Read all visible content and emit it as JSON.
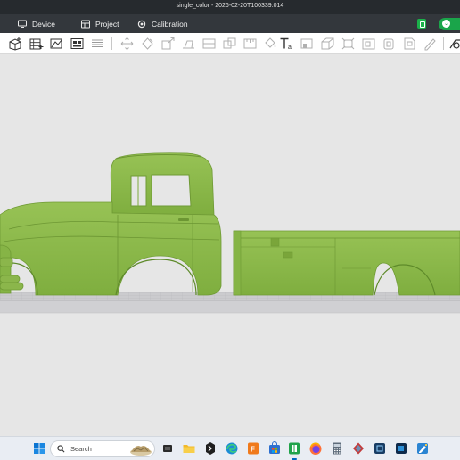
{
  "window": {
    "title": "single_color - 2026-02-20T100339.014"
  },
  "menu": {
    "items": [
      {
        "label": "Device",
        "icon": "monitor-icon"
      },
      {
        "label": "Project",
        "icon": "project-icon"
      },
      {
        "label": "Calibration",
        "icon": "calibration-icon"
      }
    ]
  },
  "toolbar": {
    "tools": [
      "add-object",
      "add-plate",
      "auto-orient",
      "arrange",
      "split-objects",
      "move",
      "rotate",
      "scale",
      "lay-on-face",
      "cut",
      "boolean",
      "measure",
      "assembly",
      "seam-painting",
      "support-painting",
      "text",
      "support",
      "multi-object",
      "orient-plate",
      "lay-flat",
      "variable-layer-height",
      "pin",
      "brim-ears",
      "emboss"
    ]
  },
  "viewport": {
    "model_color": "#8db84a",
    "plate_color": "#c9c9cc",
    "background": "#e6e6e6"
  },
  "taskbar": {
    "search_placeholder": "Search",
    "apps": [
      "windows-start",
      "search",
      "news-widget",
      "task-view",
      "file-explorer",
      "terminal",
      "edge",
      "fusion",
      "ms-store",
      "orca-slicer",
      "firefox",
      "calculator",
      "prusa-slicer",
      "camera-app",
      "photo-app",
      "editor"
    ],
    "active_app": "orca-slicer"
  }
}
